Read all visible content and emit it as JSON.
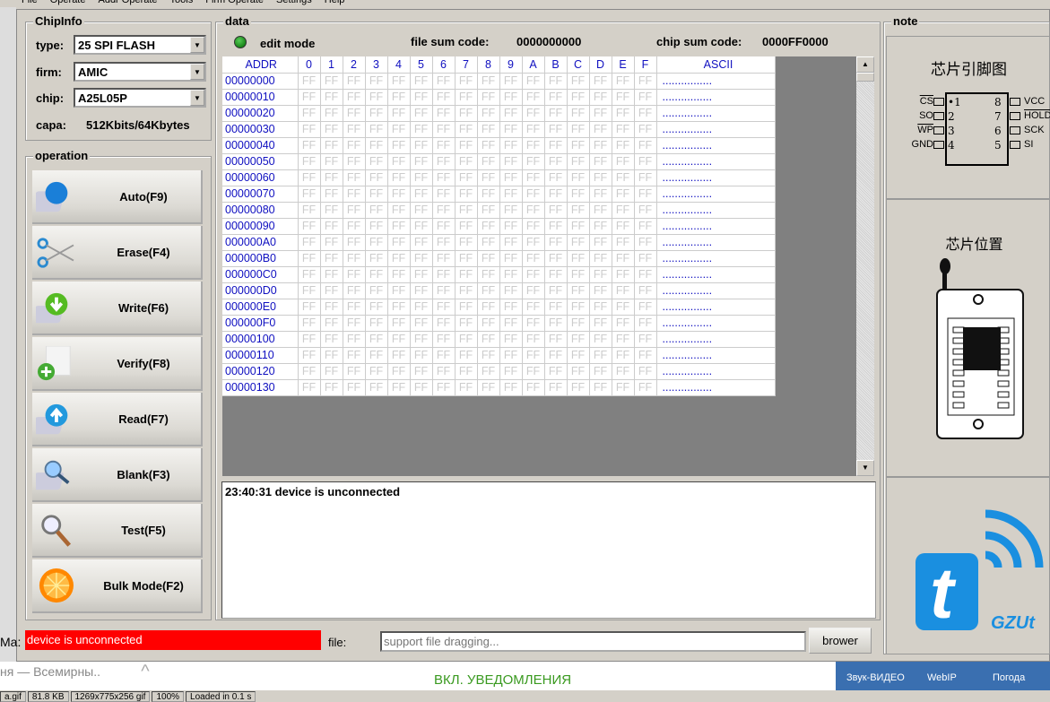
{
  "menu": [
    "File",
    "Operate",
    "Addr Operate",
    "Tools",
    "Firm Operate",
    "Settings",
    "Help"
  ],
  "chipinfo": {
    "title": "ChipInfo",
    "type_label": "type:",
    "type_value": "25 SPI FLASH",
    "firm_label": "firm:",
    "firm_value": "AMIC",
    "chip_label": "chip:",
    "chip_value": "A25L05P",
    "capa_label": "capa:",
    "capa_value": "512Kbits/64Kbytes"
  },
  "operation": {
    "title": "operation",
    "buttons": [
      {
        "label": "Auto(F9)",
        "icon": "globe-book-icon"
      },
      {
        "label": "Erase(F4)",
        "icon": "scissors-icon"
      },
      {
        "label": "Write(F6)",
        "icon": "write-down-arrow-icon"
      },
      {
        "label": "Verify(F8)",
        "icon": "verify-plus-icon"
      },
      {
        "label": "Read(F7)",
        "icon": "read-up-arrow-icon"
      },
      {
        "label": "Blank(F3)",
        "icon": "blank-magnifier-icon"
      },
      {
        "label": "Test(F5)",
        "icon": "magnifier-icon"
      },
      {
        "label": "Bulk Mode(F2)",
        "icon": "orange-slice-icon"
      }
    ]
  },
  "data": {
    "title": "data",
    "edit_mode": "edit mode",
    "file_sum_label": "file sum code:",
    "file_sum": "0000000000",
    "chip_sum_label": "chip sum code:",
    "chip_sum": "0000FF0000",
    "headers": [
      "ADDR",
      "0",
      "1",
      "2",
      "3",
      "4",
      "5",
      "6",
      "7",
      "8",
      "9",
      "A",
      "B",
      "C",
      "D",
      "E",
      "F",
      "ASCII"
    ],
    "addresses": [
      "00000000",
      "00000010",
      "00000020",
      "00000030",
      "00000040",
      "00000050",
      "00000060",
      "00000070",
      "00000080",
      "00000090",
      "000000A0",
      "000000B0",
      "000000C0",
      "000000D0",
      "000000E0",
      "000000F0",
      "00000100",
      "00000110",
      "00000120",
      "00000130"
    ],
    "cell_value": "FF",
    "ascii_value": "................"
  },
  "log": [
    "23:40:31  device is unconnected"
  ],
  "note": {
    "title": "note",
    "pin_title": "芯片引脚图",
    "pins_left": [
      {
        "n": "•1",
        "name": "CS"
      },
      {
        "n": "2",
        "name": "SO"
      },
      {
        "n": "3",
        "name": "WP"
      },
      {
        "n": "4",
        "name": "GND"
      }
    ],
    "pins_right": [
      {
        "n": "8",
        "name": "VCC"
      },
      {
        "n": "7",
        "name": "HOLD"
      },
      {
        "n": "6",
        "name": "SCK"
      },
      {
        "n": "5",
        "name": "SI"
      }
    ],
    "position_title": "芯片位置",
    "logo_text": "GZUt"
  },
  "status": {
    "device": "device is unconnected",
    "file_label": "file:",
    "file_placeholder": "support file dragging...",
    "browse": "brower"
  },
  "colors": {
    "status_red": "#ff0000",
    "hex_blue": "#1010c0",
    "logo_blue": "#1a8fe0"
  },
  "background": {
    "left_text": "Ma:",
    "tab_text": "ня — Всемирны..",
    "notify": "ВКЛ. УВЕДОМЛЕНИЯ",
    "tray": [
      "Звук-ВИДЕО",
      "WebIP",
      "Погода"
    ],
    "statusbar": [
      "a.gif",
      "81.8 KB",
      "1269x775x256 gif",
      "100%",
      "Loaded in 0.1 s"
    ]
  }
}
